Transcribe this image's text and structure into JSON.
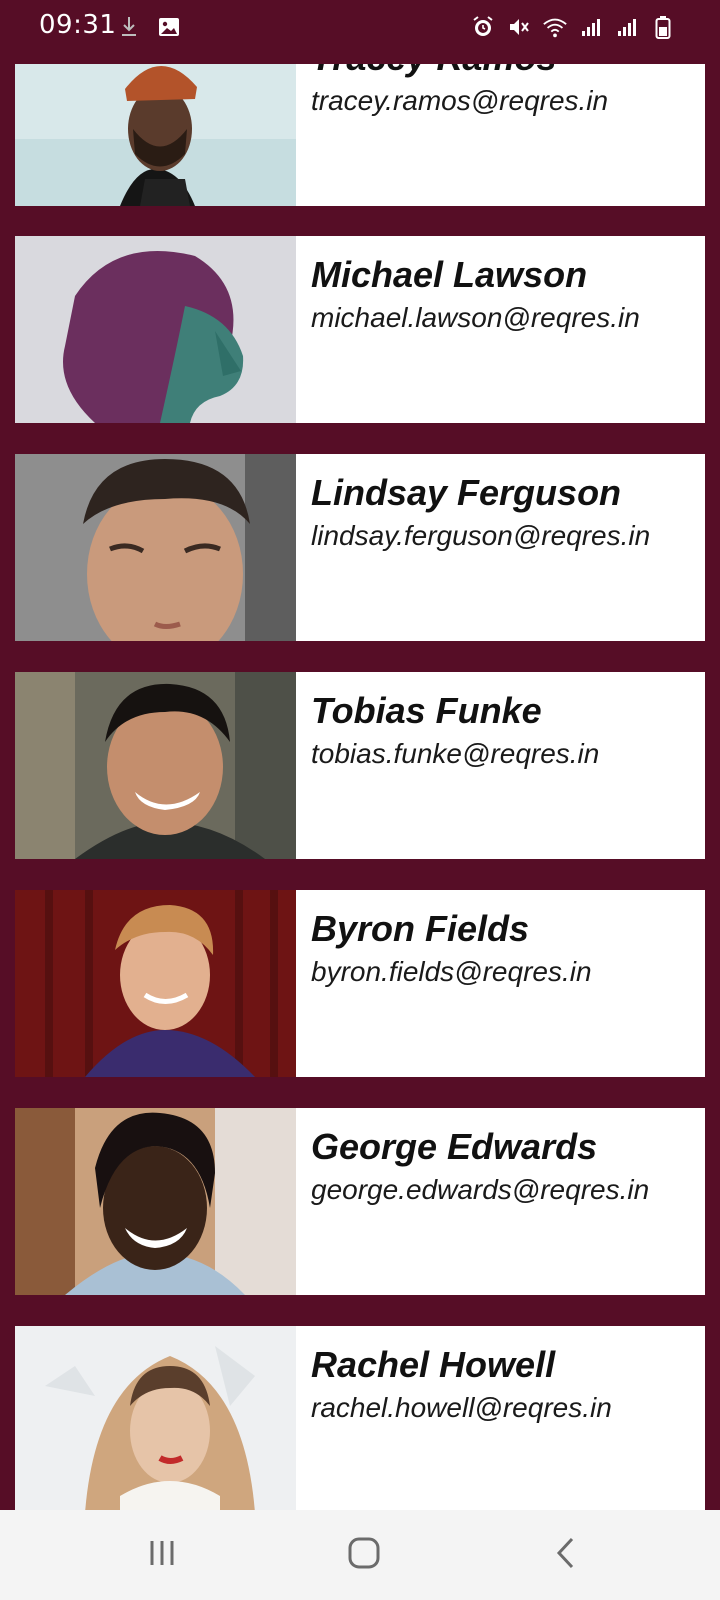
{
  "status_bar": {
    "time": "09:31",
    "left_icons": [
      "download-icon",
      "image-icon"
    ],
    "right_icons": [
      "alarm-icon",
      "mute-icon",
      "wifi-icon",
      "signal-icon",
      "signal-icon",
      "battery-icon"
    ]
  },
  "users": [
    {
      "name": "Tracey Ramos",
      "email": "tracey.ramos@reqres.in",
      "avatar_bg": "#cfe3e6",
      "avatar_fg": "#5a3b2c"
    },
    {
      "name": "Michael Lawson",
      "email": "michael.lawson@reqres.in",
      "avatar_bg": "#d6d6da",
      "avatar_fg": "#7a3a6b"
    },
    {
      "name": "Lindsay Ferguson",
      "email": "lindsay.ferguson@reqres.in",
      "avatar_bg": "#9a9a9a",
      "avatar_fg": "#c89b7e"
    },
    {
      "name": "Tobias Funke",
      "email": "tobias.funke@reqres.in",
      "avatar_bg": "#6b6b5e",
      "avatar_fg": "#c48e6d"
    },
    {
      "name": "Byron Fields",
      "email": "byron.fields@reqres.in",
      "avatar_bg": "#6e1414",
      "avatar_fg": "#e2b08f"
    },
    {
      "name": "George Edwards",
      "email": "george.edwards@reqres.in",
      "avatar_bg": "#c9a07c",
      "avatar_fg": "#3a2418"
    },
    {
      "name": "Rachel Howell",
      "email": "rachel.howell@reqres.in",
      "avatar_bg": "#eef0f2",
      "avatar_fg": "#d9b99a"
    }
  ],
  "nav_bar": {
    "recent_icon": "recent-apps-icon",
    "home_icon": "home-icon",
    "back_icon": "back-icon"
  },
  "colors": {
    "background": "#560d26",
    "card": "#ffffff",
    "nav_bar": "#f4f4f4"
  }
}
